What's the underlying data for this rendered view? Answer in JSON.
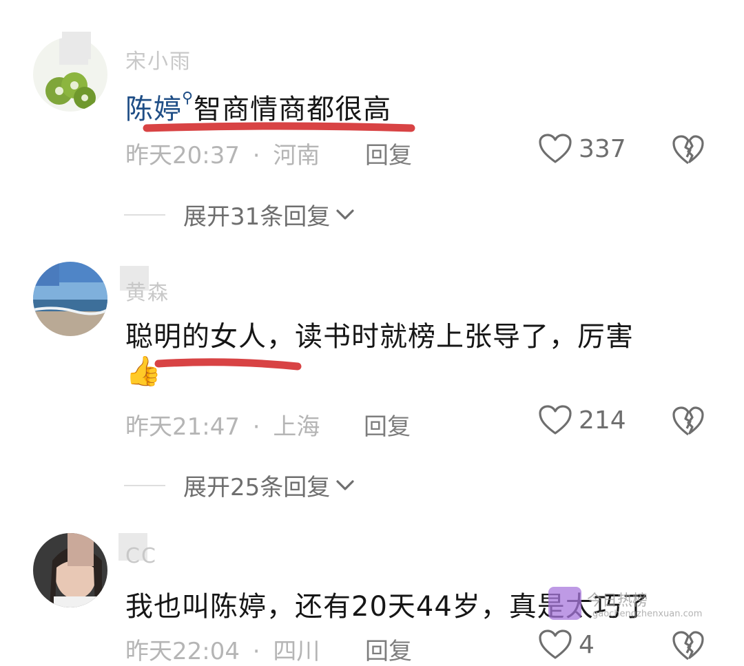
{
  "comments": [
    {
      "username": "宋小雨",
      "mention": "陈婷",
      "text": "智商情商都很高",
      "time": "昨天20:37",
      "location": "河南",
      "reply_label": "回复",
      "likes": "337",
      "expand_label": "展开31条回复"
    },
    {
      "username": "黄森",
      "text": "聪明的女人，读书时就榜上张导了，厉害",
      "emoji": "👍",
      "time": "昨天21:47",
      "location": "上海",
      "reply_label": "回复",
      "likes": "214",
      "expand_label": "展开25条回复"
    },
    {
      "username": "CC",
      "text": "我也叫陈婷，还有20天44岁，真是太巧了",
      "time": "昨天22:04",
      "location": "四川",
      "reply_label": "回复",
      "likes": "4"
    }
  ],
  "separator": "·",
  "watermark": {
    "title": "今日热榜",
    "url": "gaochengzhenxuan.com"
  },
  "colors": {
    "mention": "#1f4e86",
    "highlight_underline": "#d84344",
    "meta_text": "#b5b5b5"
  }
}
